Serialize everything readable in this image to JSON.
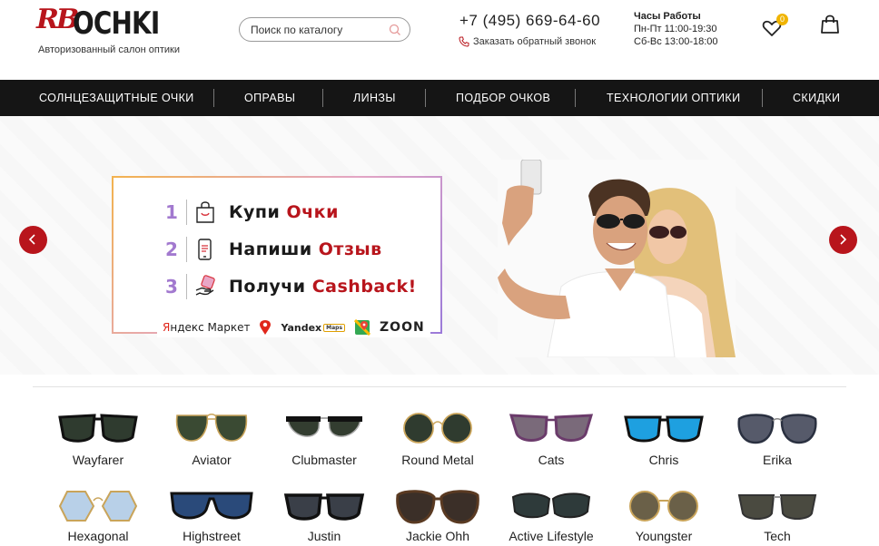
{
  "header": {
    "logo_rb": "RB",
    "logo_text": "OCHKI",
    "tagline": "Авторизованный салон оптики",
    "search_placeholder": "Поиск по каталогу",
    "phone": "+7 (495) 669-64-60",
    "callback": "Заказать обратный звонок",
    "hours_title": "Часы Работы",
    "hours_weekdays": "Пн-Пт 11:00-19:30",
    "hours_weekend": "Сб-Вс 13:00-18:00",
    "wishlist_count": "0"
  },
  "nav": {
    "items": [
      {
        "label": "СОЛНЦЕЗАЩИТНЫЕ ОЧКИ"
      },
      {
        "label": "ОПРАВЫ"
      },
      {
        "label": "ЛИНЗЫ"
      },
      {
        "label": "ПОДБОР ОЧКОВ"
      },
      {
        "label": "ТЕХНОЛОГИИ ОПТИКИ"
      },
      {
        "label": "СКИДКИ"
      }
    ]
  },
  "banner": {
    "steps": [
      {
        "num": "1",
        "text": "Купи ",
        "accent": "Очки"
      },
      {
        "num": "2",
        "text": "Напиши ",
        "accent": "Отзыв"
      },
      {
        "num": "3",
        "text": "Получи ",
        "accent": "Cashback!"
      }
    ],
    "partners": {
      "yandex_market_y": "Я",
      "yandex_market_rest": "ндекс Маркет",
      "yandex": "Yandex",
      "maps": "Maps",
      "zoon": "ZOON"
    }
  },
  "products": [
    {
      "name": "Wayfarer"
    },
    {
      "name": "Aviator"
    },
    {
      "name": "Clubmaster"
    },
    {
      "name": "Round Metal"
    },
    {
      "name": "Cats"
    },
    {
      "name": "Chris"
    },
    {
      "name": "Erika"
    },
    {
      "name": "Hexagonal"
    },
    {
      "name": "Highstreet"
    },
    {
      "name": "Justin"
    },
    {
      "name": "Jackie Ohh"
    },
    {
      "name": "Active Lifestyle"
    },
    {
      "name": "Youngster"
    },
    {
      "name": "Tech"
    }
  ],
  "colors": {
    "brand_red": "#b8151c",
    "nav_bg": "#151515",
    "badge": "#f0b400"
  }
}
